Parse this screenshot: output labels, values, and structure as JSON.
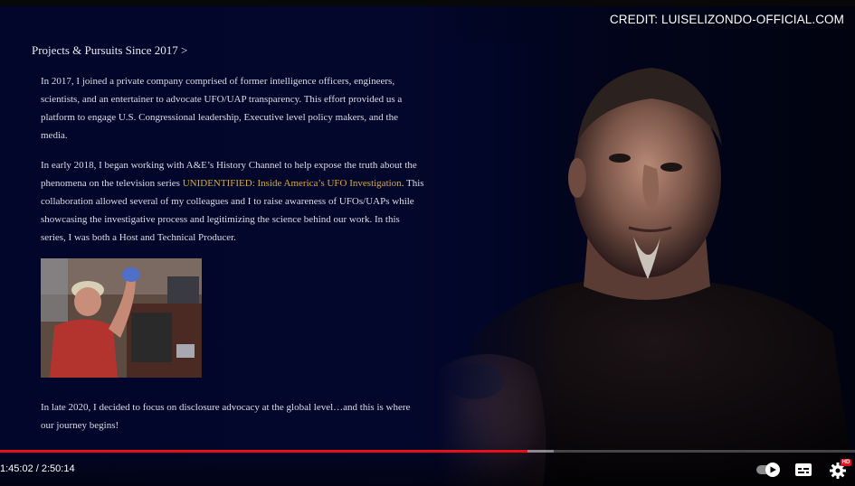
{
  "video": {
    "credit": "CREDIT: LUISELIZONDO-OFFICIAL.COM",
    "heading": "Projects & Pursuits Since 2017 >",
    "paragraph1": "In 2017, I joined a private company comprised of former intelligence officers, engineers, scientists, and an entertainer to advocate UFO/UAP transparency. This effort provided us a platform to engage U.S. Congressional leadership, Executive level policy makers, and the media.",
    "paragraph2_before": "In early 2018, I began working with A&E’s History Channel to help expose the truth about the phenomena on the television series ",
    "paragraph2_link": "UNIDENTIFIED: Inside America’s UFO Investigation",
    "paragraph2_after": ". This collaboration allowed several of my colleagues and I to raise awareness of UFOs/UAPs while showcasing the investigative process and legitimizing the science behind our work. In this series, I was both a Host and Technical Producer.",
    "paragraph3": "In late 2020, I decided to focus on disclosure advocacy at the global level…and this is where our journey begins!",
    "link_color": "#d7a93a",
    "background_color": "#02062a"
  },
  "player": {
    "time": "1:45:02 / 2:50:14",
    "progress_fraction": 0.6169,
    "buffered_fraction": 0.648,
    "progress_color": "#e5101b",
    "hd_badge": "HD",
    "icons": [
      "autoplay-toggle-icon",
      "subtitles-icon",
      "settings-icon"
    ]
  }
}
